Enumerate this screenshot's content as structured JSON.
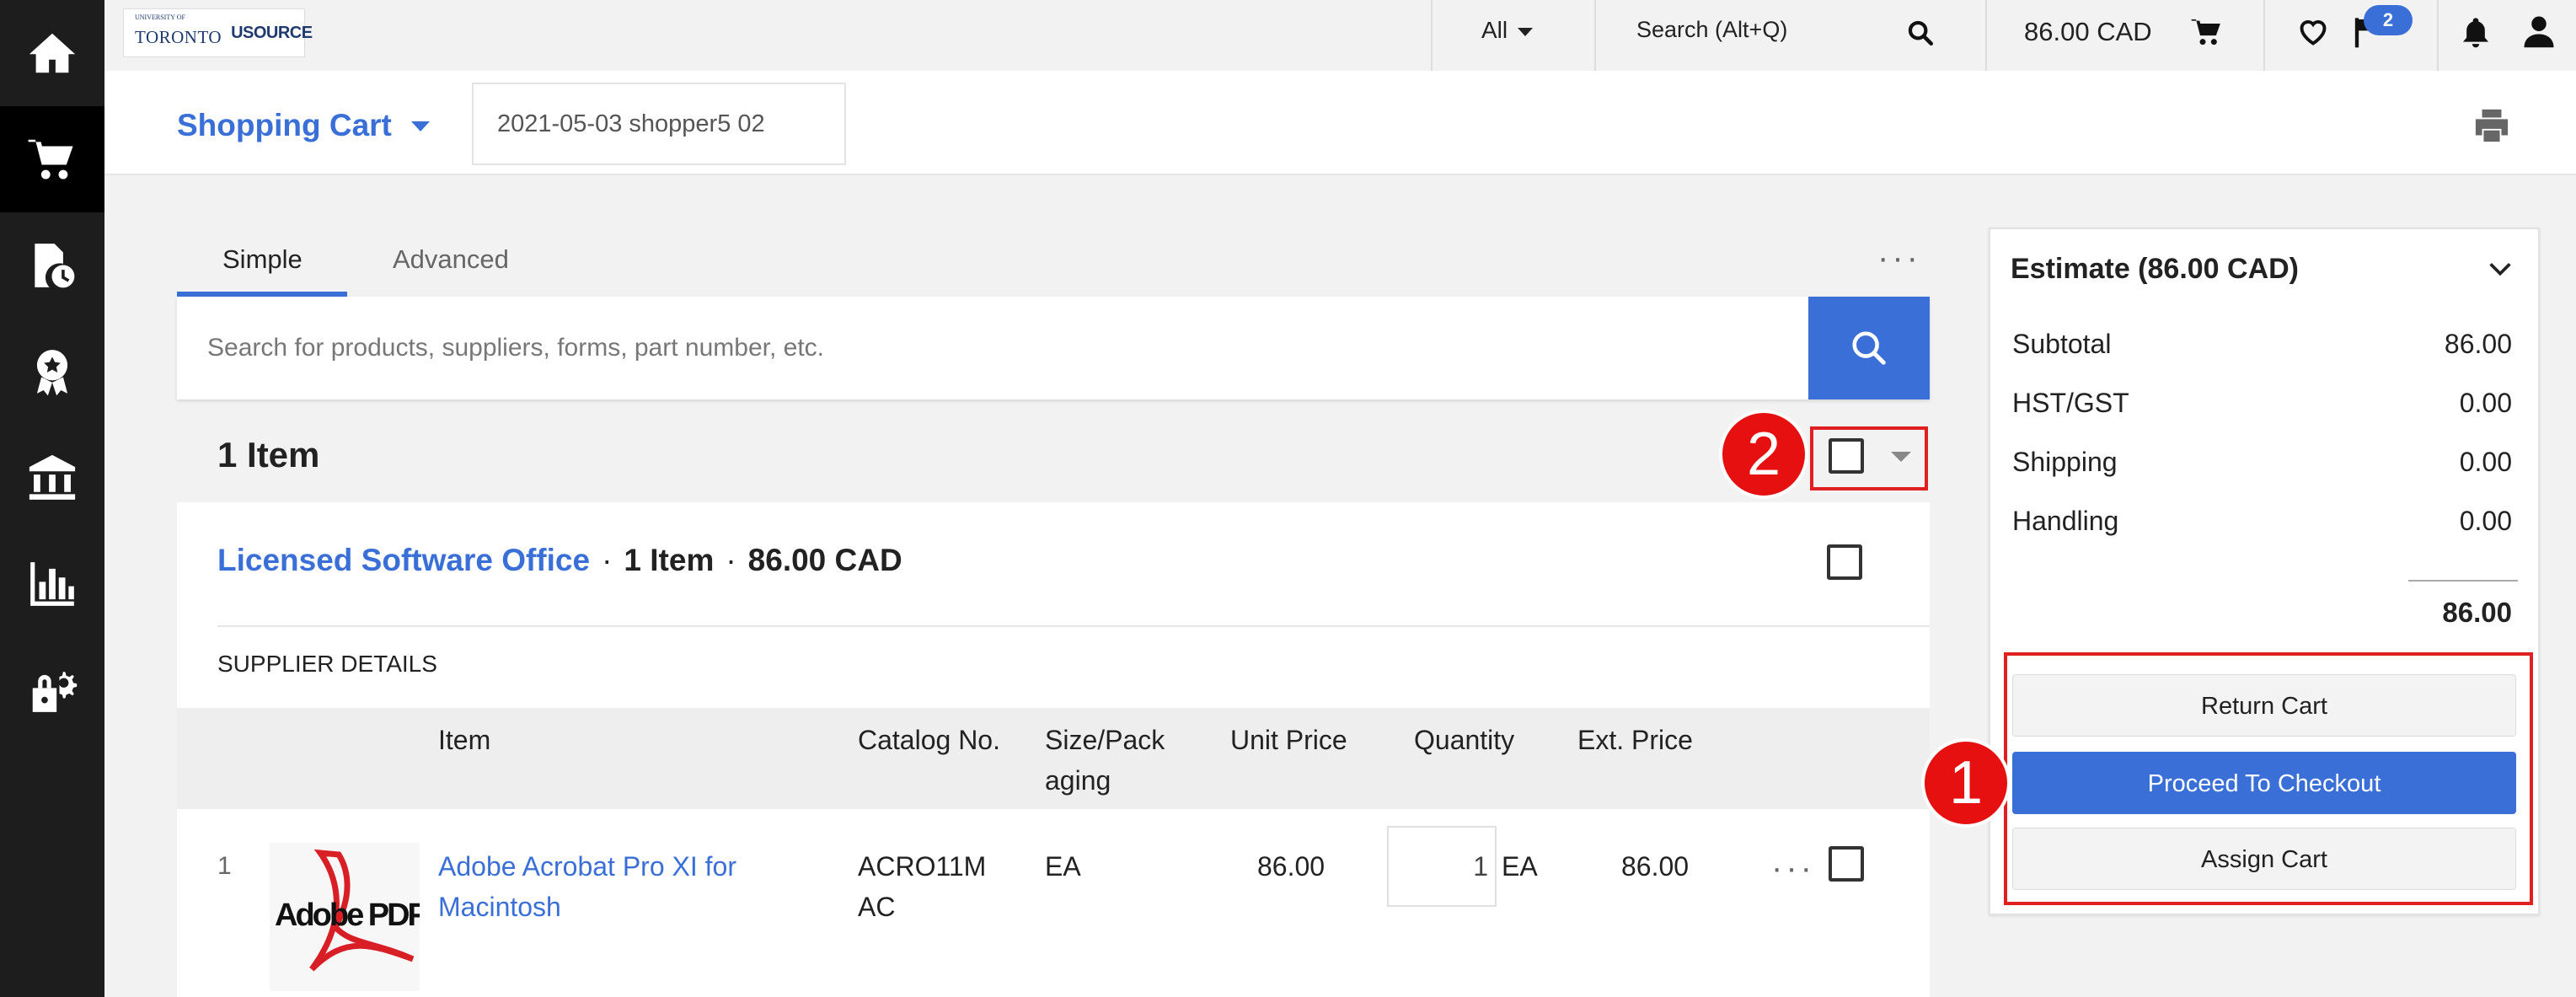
{
  "sidebar": {
    "icons": [
      "home-icon",
      "shopping-cart-icon",
      "document-history-icon",
      "award-ribbon-icon",
      "bank-icon",
      "bar-chart-icon",
      "lock-gear-icon"
    ]
  },
  "topbar": {
    "logo": {
      "small_text": "UNIVERSITY OF",
      "university": "TORONTO",
      "system": "USOURCE"
    },
    "scope_selected": "All",
    "search_label": "Search (Alt+Q)",
    "cart_total": "86.00 CAD",
    "notification_badge": "2"
  },
  "cart_header": {
    "title": "Shopping Cart",
    "cart_name": "2021-05-03 shopper5 02"
  },
  "tabs": [
    {
      "label": "Simple",
      "active": true
    },
    {
      "label": "Advanced",
      "active": false
    }
  ],
  "more_label": "···",
  "search": {
    "placeholder": "Search for products, suppliers, forms, part number, etc."
  },
  "items_count": "1 Item",
  "annotations": {
    "one": "1",
    "two": "2"
  },
  "group": {
    "supplier": "Licensed Software Office",
    "item_count": "1 Item",
    "amount": "86.00 CAD",
    "separator": "·",
    "supplier_details": "SUPPLIER DETAILS"
  },
  "table": {
    "headers": {
      "item": "Item",
      "catalog_line1": "Catalog No.",
      "size_line1": "Size/Pack",
      "size_line2": "aging",
      "unit_price": "Unit Price",
      "quantity": "Quantity",
      "ext_price": "Ext. Price"
    },
    "rows": [
      {
        "index": "1",
        "image_label": "Adobe PDF",
        "name_line1": "Adobe Acrobat Pro XI for",
        "name_line2": "Macintosh",
        "catalog_line1": "ACRO11M",
        "catalog_line2": "AC",
        "size": "EA",
        "unit_price": "86.00",
        "quantity": "1",
        "uom": "EA",
        "ext_price": "86.00",
        "more": "···"
      }
    ]
  },
  "summary": {
    "title": "Estimate (86.00 CAD)",
    "lines": [
      {
        "label": "Subtotal",
        "value": "86.00"
      },
      {
        "label": "HST/GST",
        "value": "0.00"
      },
      {
        "label": "Shipping",
        "value": "0.00"
      },
      {
        "label": "Handling",
        "value": "0.00"
      }
    ],
    "total": "86.00",
    "buttons": {
      "return": "Return Cart",
      "checkout": "Proceed To Checkout",
      "assign": "Assign Cart"
    }
  },
  "colors": {
    "accent": "#3a6fd8",
    "sidebar": "#1d1d1d",
    "annotation_red": "#e02020"
  }
}
